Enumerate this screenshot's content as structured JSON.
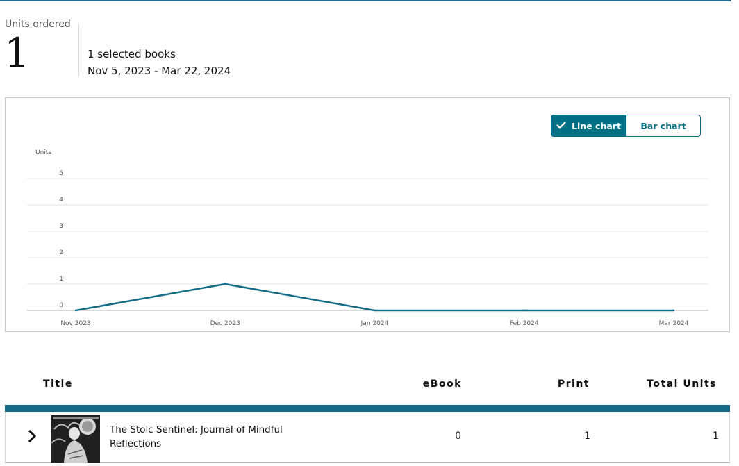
{
  "summary": {
    "units_label": "Units ordered",
    "units_value": "1",
    "selected_books": "1 selected books",
    "date_range": "Nov 5, 2023 - Mar 22, 2024"
  },
  "chart_toggle": {
    "line_label": "Line chart",
    "bar_label": "Bar chart",
    "active": "line"
  },
  "chart_data": {
    "type": "line",
    "ylabel": "Units",
    "ylim": [
      0,
      5
    ],
    "yticks": [
      0,
      1,
      2,
      3,
      4,
      5
    ],
    "categories": [
      "Nov 2023",
      "Dec 2023",
      "Jan 2024",
      "Feb 2024",
      "Mar 2024"
    ],
    "values": [
      0,
      1,
      0,
      0,
      0
    ],
    "grid": true,
    "color": "#146c87"
  },
  "table": {
    "headers": {
      "title": "Title",
      "ebook": "eBook",
      "print": "Print",
      "total": "Total Units"
    },
    "rows": [
      {
        "title": "The Stoic Sentinel: Journal of Mindful Reflections",
        "ebook": "0",
        "print": "1",
        "total": "1"
      }
    ]
  },
  "colors": {
    "accent": "#007185",
    "header_bar": "#146c87"
  }
}
